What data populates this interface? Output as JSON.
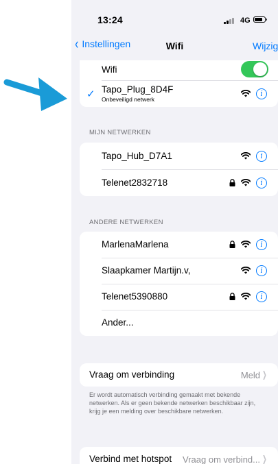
{
  "status": {
    "time": "13:24",
    "network": "4G"
  },
  "nav": {
    "back_label": "Instellingen",
    "title": "Wifi",
    "edit_label": "Wijzig"
  },
  "wifi_section": {
    "toggle_label": "Wifi",
    "toggle_on": true,
    "connected": {
      "name": "Tapo_Plug_8D4F",
      "subtitle": "Onbeveiligd netwerk"
    }
  },
  "my_networks": {
    "header": "MIJN NETWERKEN",
    "items": [
      {
        "name": "Tapo_Hub_D7A1",
        "locked": false
      },
      {
        "name": "Telenet2832718",
        "locked": true
      }
    ]
  },
  "other_networks": {
    "header": "ANDERE NETWERKEN",
    "items": [
      {
        "name": "MarlenaMarlena",
        "locked": true
      },
      {
        "name": "Slaapkamer Martijn.v,",
        "locked": false
      },
      {
        "name": "Telenet5390880",
        "locked": true
      }
    ],
    "other_label": "Ander..."
  },
  "ask_to_join": {
    "label": "Vraag om verbinding",
    "value": "Meld",
    "footer": "Er wordt automatisch verbinding gemaakt met bekende netwerken. Als er geen bekende netwerken beschikbaar zijn, krijg je een melding over beschikbare netwerken."
  },
  "hotspot": {
    "label": "Verbind met hotspot",
    "value": "Vraag om verbind..."
  },
  "colors": {
    "accent": "#007aff",
    "toggle_on": "#34c759",
    "background": "#f2f2f7",
    "arrow": "#1a9bd7"
  },
  "icons": [
    "chevron-left-icon",
    "checkmark-icon",
    "wifi-icon",
    "lock-icon",
    "info-icon",
    "chevron-right-icon",
    "battery-icon",
    "signal-icon",
    "arrow-pointer-icon"
  ]
}
